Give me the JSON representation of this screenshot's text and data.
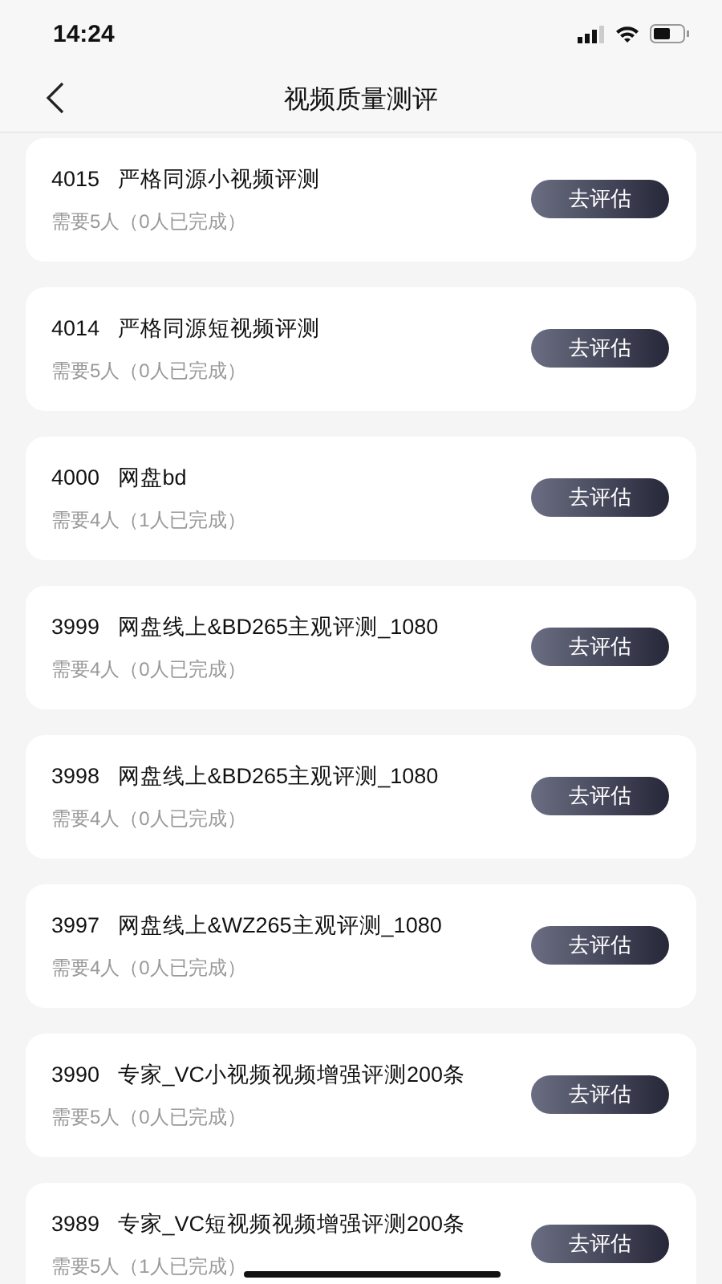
{
  "status_bar": {
    "time": "14:24"
  },
  "nav": {
    "title": "视频质量测评"
  },
  "tasks": [
    {
      "id": "4015",
      "name": "严格同源小视频评测",
      "need": "需要5人（0人已完成）",
      "action": "去评估"
    },
    {
      "id": "4014",
      "name": "严格同源短视频评测",
      "need": "需要5人（0人已完成）",
      "action": "去评估"
    },
    {
      "id": "4000",
      "name": "网盘bd",
      "need": "需要4人（1人已完成）",
      "action": "去评估"
    },
    {
      "id": "3999",
      "name": "网盘线上&BD265主观评测_1080",
      "need": "需要4人（0人已完成）",
      "action": "去评估"
    },
    {
      "id": "3998",
      "name": "网盘线上&BD265主观评测_1080",
      "need": "需要4人（0人已完成）",
      "action": "去评估"
    },
    {
      "id": "3997",
      "name": "网盘线上&WZ265主观评测_1080",
      "need": "需要4人（0人已完成）",
      "action": "去评估"
    },
    {
      "id": "3990",
      "name": "专家_VC小视频视频增强评测200条",
      "need": "需要5人（0人已完成）",
      "action": "去评估"
    },
    {
      "id": "3989",
      "name": "专家_VC短视频视频增强评测200条",
      "need": "需要5人（1人已完成）",
      "action": "去评估"
    }
  ]
}
